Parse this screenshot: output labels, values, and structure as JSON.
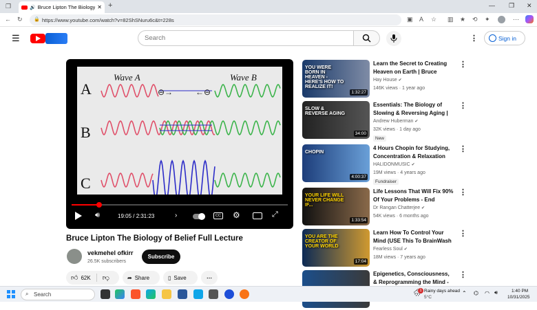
{
  "browser": {
    "tab_title": "Bruce Lipton The Biology of",
    "url": "https://www.youtube.com/watch?v=82ShSNuru6c&t=228s"
  },
  "youtube": {
    "search_placeholder": "Search",
    "signin_label": "Sign in"
  },
  "video": {
    "title": "Bruce Lipton The Biology of Belief Full Lecture",
    "time": "19:05 / 2:31:23",
    "progress_fraction": 0.126,
    "slide": {
      "wave_a": "Wave A",
      "wave_b": "Wave B",
      "row_a": "A",
      "row_b": "B",
      "row_c": "C"
    }
  },
  "channel": {
    "name": "vekmehel ofkirr",
    "subscribers": "26.5K subscribers",
    "subscribe_label": "Subscribe"
  },
  "actions": {
    "likes": "62K",
    "share": "Share",
    "save": "Save"
  },
  "recommendations": [
    {
      "title": "Learn the Secret to Creating Heaven on Earth | Bruce Lipto...",
      "channel": "Hay House",
      "meta": "146K views · 1 year ago",
      "duration": "1:32:27",
      "thumb_text": "YOU WERE BORN IN HEAVEN - HERE'S HOW TO REALIZE IT!",
      "badge": ""
    },
    {
      "title": "Essentials: The Biology of Slowing & Reversing Aging | Dr...",
      "channel": "Andrew Huberman",
      "meta": "32K views · 1 day ago",
      "duration": "34:00",
      "thumb_text": "SLOW & REVERSE AGING",
      "badge": "New"
    },
    {
      "title": "4 Hours Chopin for Studying, Concentration & Relaxation",
      "channel": "HALIDONMUSIC",
      "meta": "19M views · 4 years ago",
      "duration": "4:00:37",
      "thumb_text": "CHOPIN",
      "badge": "Fundraiser"
    },
    {
      "title": "Life Lessons That Will Fix 90% Of Your Problems - End Feelin...",
      "channel": "Dr Rangan Chatterjee",
      "meta": "54K views · 6 months ago",
      "duration": "1:33:54",
      "thumb_text": "YOUR LIFE WILL NEVER CHANGE IF...",
      "badge": ""
    },
    {
      "title": "Learn How To Control Your Mind (USE This To BrainWash ...",
      "channel": "Fearless Soul",
      "meta": "18M views · 7 years ago",
      "duration": "17:04",
      "thumb_text": "YOU ARE THE CREATOR OF YOUR WORLD",
      "badge": ""
    },
    {
      "title": "Epigenetics, Consciousness, & Reprogramming the Mind - Dr",
      "channel": "",
      "meta": "",
      "duration": "",
      "thumb_text": "",
      "badge": ""
    }
  ],
  "taskbar": {
    "search_label": "Search",
    "weather": "Rainy days ahead",
    "temperature": "5°C",
    "time": "1:40 PM",
    "date": "10/31/2025",
    "notification_count": "1"
  },
  "colors": {
    "youtube_red": "#ff0000",
    "link_blue": "#065fd4",
    "wave_red": "#e0506a",
    "wave_green": "#3cb44b",
    "wave_blue": "#2b2bc8"
  }
}
